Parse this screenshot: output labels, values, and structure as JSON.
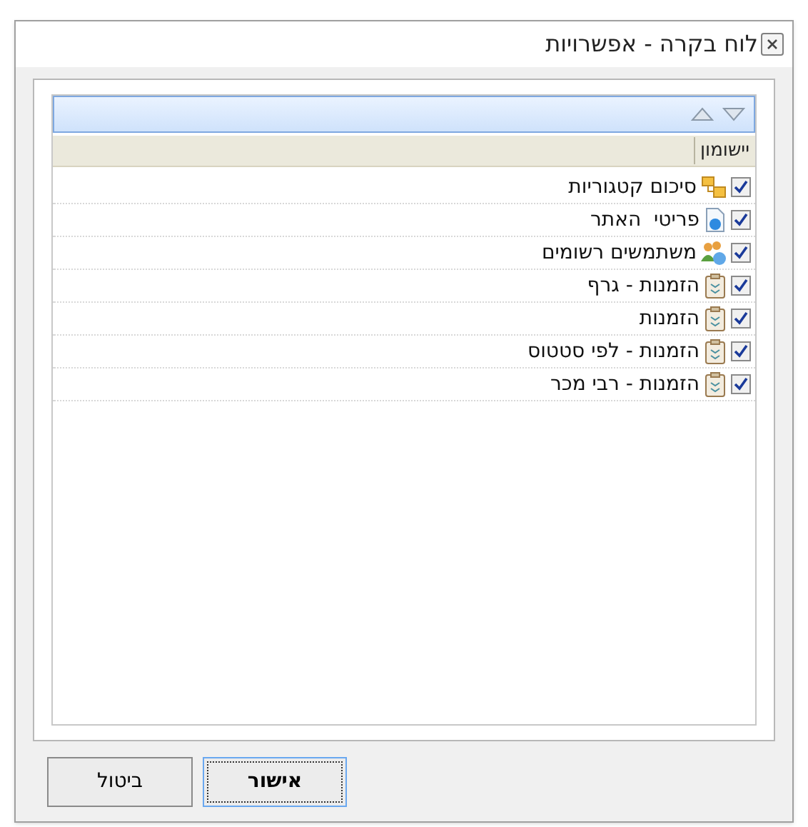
{
  "window": {
    "title": "לוח בקרה - אפשרויות"
  },
  "list": {
    "column": "יישומון",
    "items": [
      {
        "label": "סיכום קטגוריות",
        "kind": "folders",
        "checked": true
      },
      {
        "label": "פריטי  האתר",
        "kind": "page",
        "checked": true
      },
      {
        "label": "משתמשים רשומים",
        "kind": "users",
        "checked": true
      },
      {
        "label": "הזמנות - גרף",
        "kind": "clipboard",
        "checked": true
      },
      {
        "label": "הזמנות",
        "kind": "clipboard",
        "checked": true
      },
      {
        "label": "הזמנות - לפי סטטוס",
        "kind": "clipboard",
        "checked": true
      },
      {
        "label": "הזמנות - רבי מכר",
        "kind": "clipboard",
        "checked": true
      }
    ]
  },
  "buttons": [
    {
      "label": "אישור",
      "default": true
    },
    {
      "label": "ביטול",
      "default": false
    }
  ]
}
